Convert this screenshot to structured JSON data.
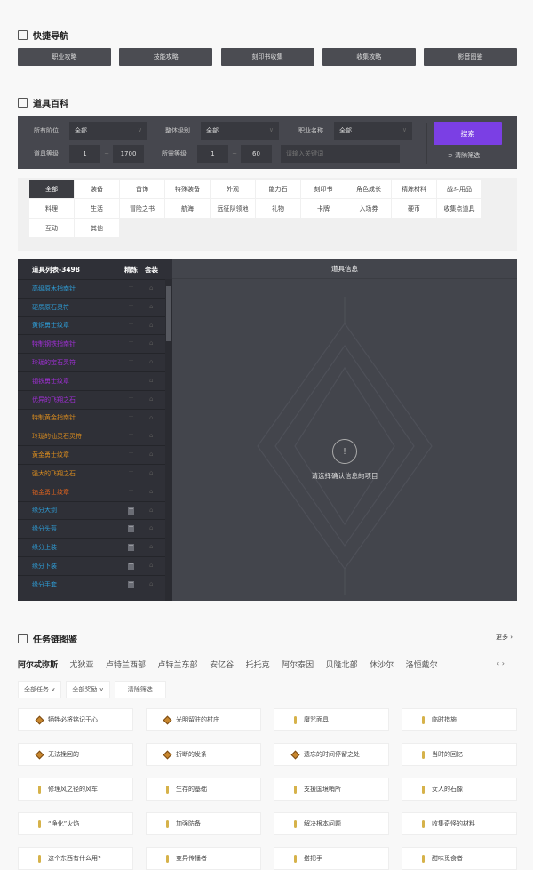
{
  "quick_nav": {
    "title": "快捷导航",
    "icon": "grid-icon",
    "buttons": [
      "职业攻略",
      "技能攻略",
      "刻印书收集",
      "收集攻略",
      "影音图鉴"
    ]
  },
  "item_wiki": {
    "title": "道具百科",
    "icon": "book-icon",
    "filters": {
      "tier_label": "所有阶位",
      "tier_value": "全部",
      "grade_label": "整体级别",
      "grade_value": "全部",
      "class_label": "职业名称",
      "class_value": "全部",
      "item_level_label": "道具等级",
      "item_level_min": "1",
      "item_level_max": "1700",
      "req_level_label": "所需等级",
      "req_level_min": "1",
      "req_level_max": "60",
      "keyword_placeholder": "请输入关键词",
      "search_label": "搜索",
      "clear_label": "清除筛选",
      "separator": "~"
    },
    "categories": [
      "全部",
      "装备",
      "首饰",
      "特殊装备",
      "外观",
      "能力石",
      "刻印书",
      "角色成长",
      "精炼材料",
      "战斗用品",
      "料理",
      "生活",
      "冒险之书",
      "航海",
      "远征队领地",
      "礼物",
      "卡牌",
      "入场券",
      "硬币",
      "收集点道具",
      "互动",
      "其他"
    ],
    "active_category": "全部",
    "list": {
      "header": "道具列表-3498",
      "col_refine": "精炼",
      "col_set": "套装",
      "items": [
        {
          "name": "高级原木指南针",
          "color": "#2f9ed8",
          "refine": false
        },
        {
          "name": "硬质原石灵符",
          "color": "#2f9ed8",
          "refine": false
        },
        {
          "name": "黄铜勇士纹章",
          "color": "#2f9ed8",
          "refine": false
        },
        {
          "name": "特制钢铁指南针",
          "color": "#a22fd8",
          "refine": false
        },
        {
          "name": "玲珑的宝石灵符",
          "color": "#a22fd8",
          "refine": false
        },
        {
          "name": "钢铁勇士纹章",
          "color": "#a22fd8",
          "refine": false
        },
        {
          "name": "优异的飞翔之石",
          "color": "#a22fd8",
          "refine": false
        },
        {
          "name": "特制黄金指南针",
          "color": "#d88b1f",
          "refine": false
        },
        {
          "name": "玲珑的仙灵石灵符",
          "color": "#d88b1f",
          "refine": false
        },
        {
          "name": "黄金勇士纹章",
          "color": "#d88b1f",
          "refine": false
        },
        {
          "name": "强大的飞翔之石",
          "color": "#d88b1f",
          "refine": false
        },
        {
          "name": "铂金勇士纹章",
          "color": "#e0631e",
          "refine": false
        },
        {
          "name": "缘分大剑",
          "color": "#2f9ed8",
          "refine": true
        },
        {
          "name": "缘分头盔",
          "color": "#2f9ed8",
          "refine": true
        },
        {
          "name": "缘分上装",
          "color": "#2f9ed8",
          "refine": true
        },
        {
          "name": "缘分下装",
          "color": "#2f9ed8",
          "refine": true
        },
        {
          "name": "缘分手套",
          "color": "#2f9ed8",
          "refine": true
        }
      ]
    },
    "info": {
      "header": "道具信息",
      "empty_text": "请选择确认信息的项目",
      "empty_icon": "!"
    }
  },
  "quests": {
    "title": "任务链图鉴",
    "icon": "scroll-icon",
    "more_label": "更多 ›",
    "regions": [
      "阿尔忒弥斯",
      "尤狄亚",
      "卢特兰西部",
      "卢特兰东部",
      "安亿谷",
      "托托克",
      "阿尔泰因",
      "贝隆北部",
      "休沙尔",
      "洛恒戴尔"
    ],
    "active_region": "阿尔忒弥斯",
    "region_prev": "‹",
    "region_next": "›",
    "filter_task": "全部任务 ∨",
    "filter_reward": "全部奖励 ∨",
    "clear_label": "清除筛选",
    "items": [
      {
        "name": "牺牲必将铭记于心",
        "icon": "diamond"
      },
      {
        "name": "光明留驻的村庄",
        "icon": "diamond"
      },
      {
        "name": "魔咒面具",
        "icon": "key"
      },
      {
        "name": "临时措施",
        "icon": "key"
      },
      {
        "name": "无法挽回的",
        "icon": "diamond"
      },
      {
        "name": "折断的发条",
        "icon": "diamond"
      },
      {
        "name": "遗忘的时间停留之处",
        "icon": "diamond"
      },
      {
        "name": "当时的回忆",
        "icon": "key"
      },
      {
        "name": "修理风之径的风车",
        "icon": "key"
      },
      {
        "name": "生存的基础",
        "icon": "key"
      },
      {
        "name": "支援国境哨所",
        "icon": "key"
      },
      {
        "name": "女人的石像",
        "icon": "key"
      },
      {
        "name": "“净化”火焰",
        "icon": "key"
      },
      {
        "name": "加强防备",
        "icon": "key"
      },
      {
        "name": "解决根本问题",
        "icon": "key"
      },
      {
        "name": "收集奇怪的材料",
        "icon": "key"
      },
      {
        "name": "这个东西有什么用?",
        "icon": "key"
      },
      {
        "name": "变异传播者",
        "icon": "key"
      },
      {
        "name": "搭把手",
        "icon": "key"
      },
      {
        "name": "甜味觅食者",
        "icon": "key"
      }
    ]
  }
}
